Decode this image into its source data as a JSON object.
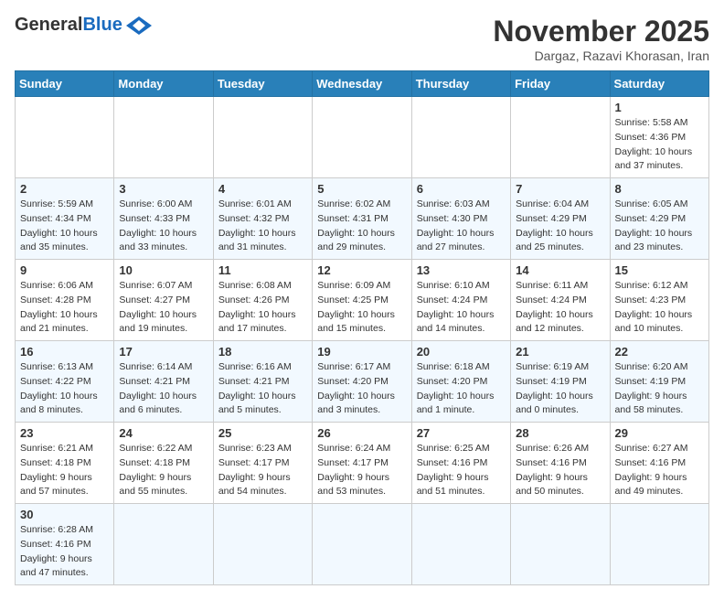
{
  "logo": {
    "general": "General",
    "blue": "Blue"
  },
  "header": {
    "month": "November 2025",
    "location": "Dargaz, Razavi Khorasan, Iran"
  },
  "weekdays": [
    "Sunday",
    "Monday",
    "Tuesday",
    "Wednesday",
    "Thursday",
    "Friday",
    "Saturday"
  ],
  "weeks": [
    [
      {
        "day": "",
        "info": ""
      },
      {
        "day": "",
        "info": ""
      },
      {
        "day": "",
        "info": ""
      },
      {
        "day": "",
        "info": ""
      },
      {
        "day": "",
        "info": ""
      },
      {
        "day": "",
        "info": ""
      },
      {
        "day": "1",
        "info": "Sunrise: 5:58 AM\nSunset: 4:36 PM\nDaylight: 10 hours and 37 minutes."
      }
    ],
    [
      {
        "day": "2",
        "info": "Sunrise: 5:59 AM\nSunset: 4:34 PM\nDaylight: 10 hours and 35 minutes."
      },
      {
        "day": "3",
        "info": "Sunrise: 6:00 AM\nSunset: 4:33 PM\nDaylight: 10 hours and 33 minutes."
      },
      {
        "day": "4",
        "info": "Sunrise: 6:01 AM\nSunset: 4:32 PM\nDaylight: 10 hours and 31 minutes."
      },
      {
        "day": "5",
        "info": "Sunrise: 6:02 AM\nSunset: 4:31 PM\nDaylight: 10 hours and 29 minutes."
      },
      {
        "day": "6",
        "info": "Sunrise: 6:03 AM\nSunset: 4:30 PM\nDaylight: 10 hours and 27 minutes."
      },
      {
        "day": "7",
        "info": "Sunrise: 6:04 AM\nSunset: 4:29 PM\nDaylight: 10 hours and 25 minutes."
      },
      {
        "day": "8",
        "info": "Sunrise: 6:05 AM\nSunset: 4:29 PM\nDaylight: 10 hours and 23 minutes."
      }
    ],
    [
      {
        "day": "9",
        "info": "Sunrise: 6:06 AM\nSunset: 4:28 PM\nDaylight: 10 hours and 21 minutes."
      },
      {
        "day": "10",
        "info": "Sunrise: 6:07 AM\nSunset: 4:27 PM\nDaylight: 10 hours and 19 minutes."
      },
      {
        "day": "11",
        "info": "Sunrise: 6:08 AM\nSunset: 4:26 PM\nDaylight: 10 hours and 17 minutes."
      },
      {
        "day": "12",
        "info": "Sunrise: 6:09 AM\nSunset: 4:25 PM\nDaylight: 10 hours and 15 minutes."
      },
      {
        "day": "13",
        "info": "Sunrise: 6:10 AM\nSunset: 4:24 PM\nDaylight: 10 hours and 14 minutes."
      },
      {
        "day": "14",
        "info": "Sunrise: 6:11 AM\nSunset: 4:24 PM\nDaylight: 10 hours and 12 minutes."
      },
      {
        "day": "15",
        "info": "Sunrise: 6:12 AM\nSunset: 4:23 PM\nDaylight: 10 hours and 10 minutes."
      }
    ],
    [
      {
        "day": "16",
        "info": "Sunrise: 6:13 AM\nSunset: 4:22 PM\nDaylight: 10 hours and 8 minutes."
      },
      {
        "day": "17",
        "info": "Sunrise: 6:14 AM\nSunset: 4:21 PM\nDaylight: 10 hours and 6 minutes."
      },
      {
        "day": "18",
        "info": "Sunrise: 6:16 AM\nSunset: 4:21 PM\nDaylight: 10 hours and 5 minutes."
      },
      {
        "day": "19",
        "info": "Sunrise: 6:17 AM\nSunset: 4:20 PM\nDaylight: 10 hours and 3 minutes."
      },
      {
        "day": "20",
        "info": "Sunrise: 6:18 AM\nSunset: 4:20 PM\nDaylight: 10 hours and 1 minute."
      },
      {
        "day": "21",
        "info": "Sunrise: 6:19 AM\nSunset: 4:19 PM\nDaylight: 10 hours and 0 minutes."
      },
      {
        "day": "22",
        "info": "Sunrise: 6:20 AM\nSunset: 4:19 PM\nDaylight: 9 hours and 58 minutes."
      }
    ],
    [
      {
        "day": "23",
        "info": "Sunrise: 6:21 AM\nSunset: 4:18 PM\nDaylight: 9 hours and 57 minutes."
      },
      {
        "day": "24",
        "info": "Sunrise: 6:22 AM\nSunset: 4:18 PM\nDaylight: 9 hours and 55 minutes."
      },
      {
        "day": "25",
        "info": "Sunrise: 6:23 AM\nSunset: 4:17 PM\nDaylight: 9 hours and 54 minutes."
      },
      {
        "day": "26",
        "info": "Sunrise: 6:24 AM\nSunset: 4:17 PM\nDaylight: 9 hours and 53 minutes."
      },
      {
        "day": "27",
        "info": "Sunrise: 6:25 AM\nSunset: 4:16 PM\nDaylight: 9 hours and 51 minutes."
      },
      {
        "day": "28",
        "info": "Sunrise: 6:26 AM\nSunset: 4:16 PM\nDaylight: 9 hours and 50 minutes."
      },
      {
        "day": "29",
        "info": "Sunrise: 6:27 AM\nSunset: 4:16 PM\nDaylight: 9 hours and 49 minutes."
      }
    ],
    [
      {
        "day": "30",
        "info": "Sunrise: 6:28 AM\nSunset: 4:16 PM\nDaylight: 9 hours and 47 minutes."
      },
      {
        "day": "",
        "info": ""
      },
      {
        "day": "",
        "info": ""
      },
      {
        "day": "",
        "info": ""
      },
      {
        "day": "",
        "info": ""
      },
      {
        "day": "",
        "info": ""
      },
      {
        "day": "",
        "info": ""
      }
    ]
  ]
}
